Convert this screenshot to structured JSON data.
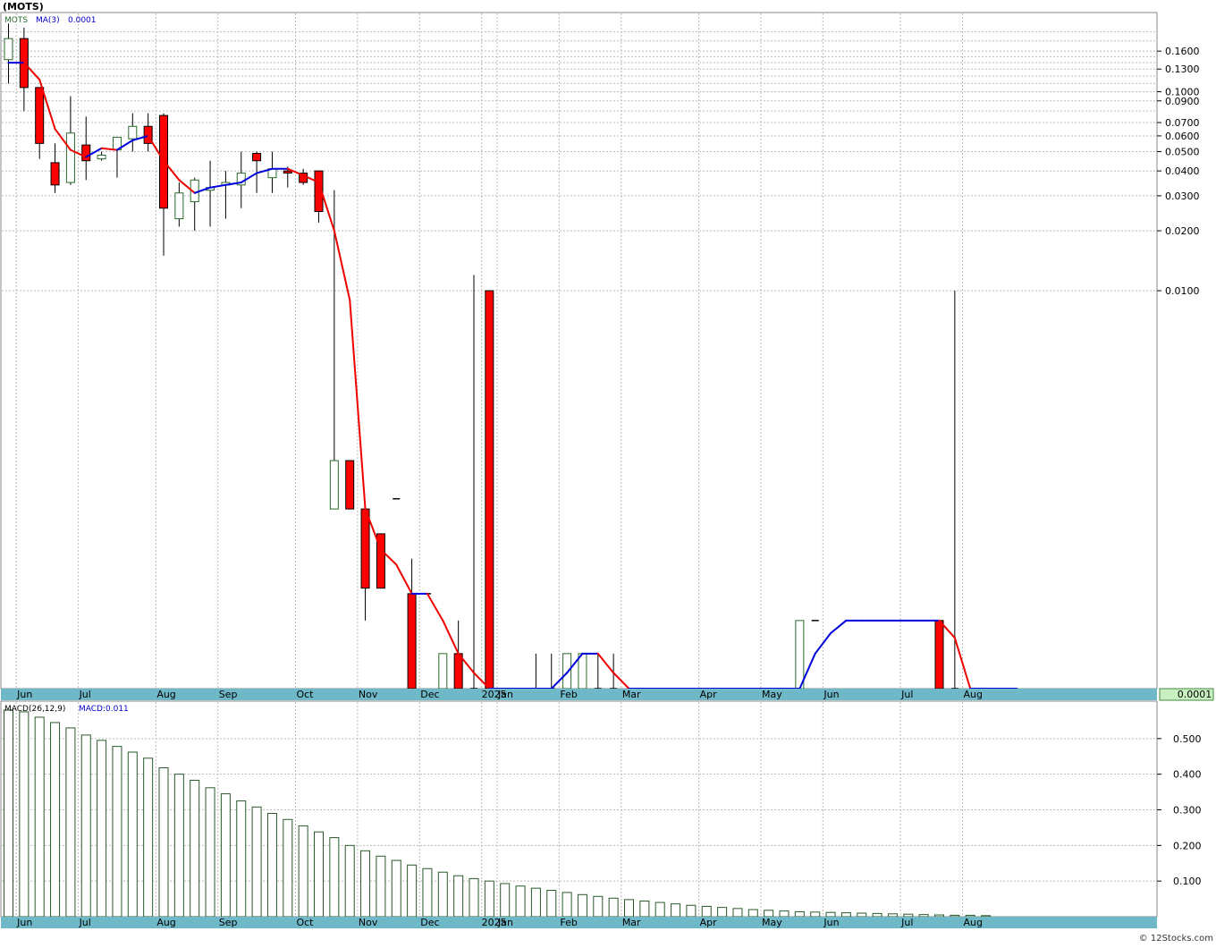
{
  "title": "(MOTS)",
  "copyright": "© 12Stocks.com",
  "colors": {
    "up": "#2a6a2a",
    "down": "#ff0000",
    "ma_up": "#0000dd",
    "ma_down": "#ee0000",
    "axis_bar": "#6fb8c8",
    "grid": "#bbbbbb",
    "macd": "#2a5a2a",
    "last_price_bg": "#c8f0c0"
  },
  "chart_data": [
    {
      "type": "candlestick",
      "ticker": "MOTS",
      "legend": {
        "ticker": "MOTS",
        "ma": "MA(3)",
        "ma_value": "0.0001"
      },
      "y_scale": "log",
      "ylim": [
        0.0001,
        0.24
      ],
      "y_ticks": [
        "0.1600",
        "0.1300",
        "0.1000",
        "0.0900",
        "0.0700",
        "0.0600",
        "0.0500",
        "0.0400",
        "0.0300",
        "0.0200",
        "0.0100"
      ],
      "last_price": "0.0001",
      "x_labels": [
        {
          "label": "Jun",
          "week": 1
        },
        {
          "label": "Jul",
          "week": 5
        },
        {
          "label": "Aug",
          "week": 10
        },
        {
          "label": "Sep",
          "week": 14
        },
        {
          "label": "Oct",
          "week": 19
        },
        {
          "label": "Nov",
          "week": 23
        },
        {
          "label": "Dec",
          "week": 27
        },
        {
          "label": "2025",
          "week": 31
        },
        {
          "label": "Jan",
          "week": 32
        },
        {
          "label": "Feb",
          "week": 36
        },
        {
          "label": "Mar",
          "week": 40
        },
        {
          "label": "Apr",
          "week": 45
        },
        {
          "label": "May",
          "week": 49
        },
        {
          "label": "Jun",
          "week": 53
        },
        {
          "label": "Jul",
          "week": 58
        },
        {
          "label": "Aug",
          "week": 62
        }
      ],
      "candles": [
        {
          "o": 0.145,
          "h": 0.22,
          "l": 0.11,
          "c": 0.185
        },
        {
          "o": 0.185,
          "h": 0.21,
          "l": 0.08,
          "c": 0.105
        },
        {
          "o": 0.105,
          "h": 0.105,
          "l": 0.046,
          "c": 0.055
        },
        {
          "o": 0.044,
          "h": 0.055,
          "l": 0.031,
          "c": 0.034
        },
        {
          "o": 0.035,
          "h": 0.095,
          "l": 0.034,
          "c": 0.062
        },
        {
          "o": 0.054,
          "h": 0.075,
          "l": 0.036,
          "c": 0.045
        },
        {
          "o": 0.046,
          "h": 0.05,
          "l": 0.045,
          "c": 0.048
        },
        {
          "o": 0.051,
          "h": 0.057,
          "l": 0.037,
          "c": 0.059
        },
        {
          "o": 0.058,
          "h": 0.078,
          "l": 0.05,
          "c": 0.067
        },
        {
          "o": 0.067,
          "h": 0.078,
          "l": 0.05,
          "c": 0.055
        },
        {
          "o": 0.076,
          "h": 0.078,
          "l": 0.015,
          "c": 0.026
        },
        {
          "o": 0.023,
          "h": 0.035,
          "l": 0.021,
          "c": 0.031
        },
        {
          "o": 0.028,
          "h": 0.037,
          "l": 0.02,
          "c": 0.036
        },
        {
          "o": 0.032,
          "h": 0.045,
          "l": 0.021,
          "c": 0.033
        },
        {
          "o": 0.034,
          "h": 0.04,
          "l": 0.023,
          "c": 0.035
        },
        {
          "o": 0.034,
          "h": 0.05,
          "l": 0.026,
          "c": 0.039
        },
        {
          "o": 0.049,
          "h": 0.05,
          "l": 0.031,
          "c": 0.045
        },
        {
          "o": 0.037,
          "h": 0.05,
          "l": 0.031,
          "c": 0.041
        },
        {
          "o": 0.04,
          "h": 0.042,
          "l": 0.033,
          "c": 0.039
        },
        {
          "o": 0.039,
          "h": 0.041,
          "l": 0.034,
          "c": 0.035
        },
        {
          "o": 0.04,
          "h": 0.04,
          "l": 0.022,
          "c": 0.025
        },
        {
          "o": 0.0008,
          "h": 0.032,
          "l": 0.0008,
          "c": 0.0014
        },
        {
          "o": 0.0014,
          "h": 0.0014,
          "l": 0.0008,
          "c": 0.0008
        },
        {
          "o": 0.0008,
          "h": 0.0008,
          "l": 0.00022,
          "c": 0.00032
        },
        {
          "o": 0.0006,
          "h": 0.0006,
          "l": 0.00032,
          "c": 0.00032
        },
        {
          "o": 0.0009,
          "h": 0.0009,
          "l": 0.0009,
          "c": 0.0009
        },
        {
          "o": 0.0003,
          "h": 0.00045,
          "l": 0.0001,
          "c": 0.0001
        },
        {
          "o": 0.0003,
          "h": 0.0003,
          "l": 0.0003,
          "c": 0.0003
        },
        {
          "o": 0.0001,
          "h": 0.00015,
          "l": 0.0001,
          "c": 0.00015
        },
        {
          "o": 0.00015,
          "h": 0.00022,
          "l": 0.0001,
          "c": 0.0001
        },
        {
          "o": 0.0001,
          "h": 0.012,
          "l": 0.0001,
          "c": 0.0001
        },
        {
          "o": 0.01,
          "h": 0.01,
          "l": 0.0001,
          "c": 0.0001
        },
        null,
        null,
        {
          "o": 0.0001,
          "h": 0.00015,
          "l": 0.0001,
          "c": 0.0001
        },
        {
          "o": 0.0001,
          "h": 0.00015,
          "l": 0.0001,
          "c": 0.0001
        },
        {
          "o": 0.0001,
          "h": 0.00015,
          "l": 0.0001,
          "c": 0.00015
        },
        {
          "o": 0.0001,
          "h": 0.00015,
          "l": 0.0001,
          "c": 0.00015
        },
        {
          "o": 0.0001,
          "h": 0.00015,
          "l": 0.0001,
          "c": 0.0001
        },
        {
          "o": 0.0001,
          "h": 0.00015,
          "l": 0.0001,
          "c": 0.0001
        },
        null,
        null,
        null,
        null,
        null,
        null,
        null,
        null,
        null,
        null,
        null,
        {
          "o": 0.0001,
          "h": 0.00022,
          "l": 0.0001,
          "c": 0.00022
        },
        {
          "o": 0.00022,
          "h": 0.00022,
          "l": 0.00022,
          "c": 0.00022
        },
        null,
        null,
        null,
        null,
        null,
        null,
        null,
        {
          "o": 0.00022,
          "h": 0.00022,
          "l": 0.0001,
          "c": 0.0001
        },
        {
          "o": 0.0001,
          "h": 0.01,
          "l": 0.0001,
          "c": 0.0001
        }
      ],
      "ma3": [
        0.14,
        0.14,
        0.115,
        0.065,
        0.051,
        0.047,
        0.052,
        0.051,
        0.057,
        0.06,
        0.045,
        0.036,
        0.031,
        0.033,
        0.034,
        0.035,
        0.039,
        0.041,
        0.041,
        0.038,
        0.035,
        0.02,
        0.009,
        0.0008,
        0.0005,
        0.00042,
        0.0003,
        0.0003,
        0.00022,
        0.00015,
        0.00012,
        0.0001,
        0.0001,
        0.0001,
        0.0001,
        0.0001,
        0.00012,
        0.00015,
        0.00015,
        0.00012,
        0.0001,
        0.0001,
        0.0001,
        0.0001,
        0.0001,
        0.0001,
        0.0001,
        0.0001,
        0.0001,
        0.0001,
        0.0001,
        0.0001,
        0.00015,
        0.00019,
        0.00022,
        0.00022,
        0.00022,
        0.00022,
        0.00022,
        0.00022,
        0.00022,
        0.00018,
        0.0001,
        0.0001,
        0.0001,
        0.0001
      ]
    },
    {
      "type": "bar",
      "legend": {
        "name": "MACD(26,12,9)",
        "label": "MACD:0.011"
      },
      "ylim": [
        0,
        0.59
      ],
      "y_ticks": [
        "0.500",
        "0.400",
        "0.300",
        "0.200",
        "0.100"
      ],
      "values": [
        0.58,
        0.575,
        0.56,
        0.545,
        0.53,
        0.51,
        0.495,
        0.478,
        0.462,
        0.445,
        0.418,
        0.4,
        0.383,
        0.362,
        0.345,
        0.325,
        0.308,
        0.29,
        0.273,
        0.255,
        0.238,
        0.222,
        0.2,
        0.185,
        0.17,
        0.158,
        0.145,
        0.135,
        0.125,
        0.115,
        0.107,
        0.1,
        0.093,
        0.086,
        0.08,
        0.074,
        0.068,
        0.062,
        0.057,
        0.052,
        0.048,
        0.044,
        0.04,
        0.036,
        0.032,
        0.029,
        0.026,
        0.023,
        0.02,
        0.018,
        0.016,
        0.014,
        0.013,
        0.012,
        0.011,
        0.01,
        0.009,
        0.008,
        0.007,
        0.006,
        0.005,
        0.004,
        0.004,
        0.003
      ]
    }
  ]
}
